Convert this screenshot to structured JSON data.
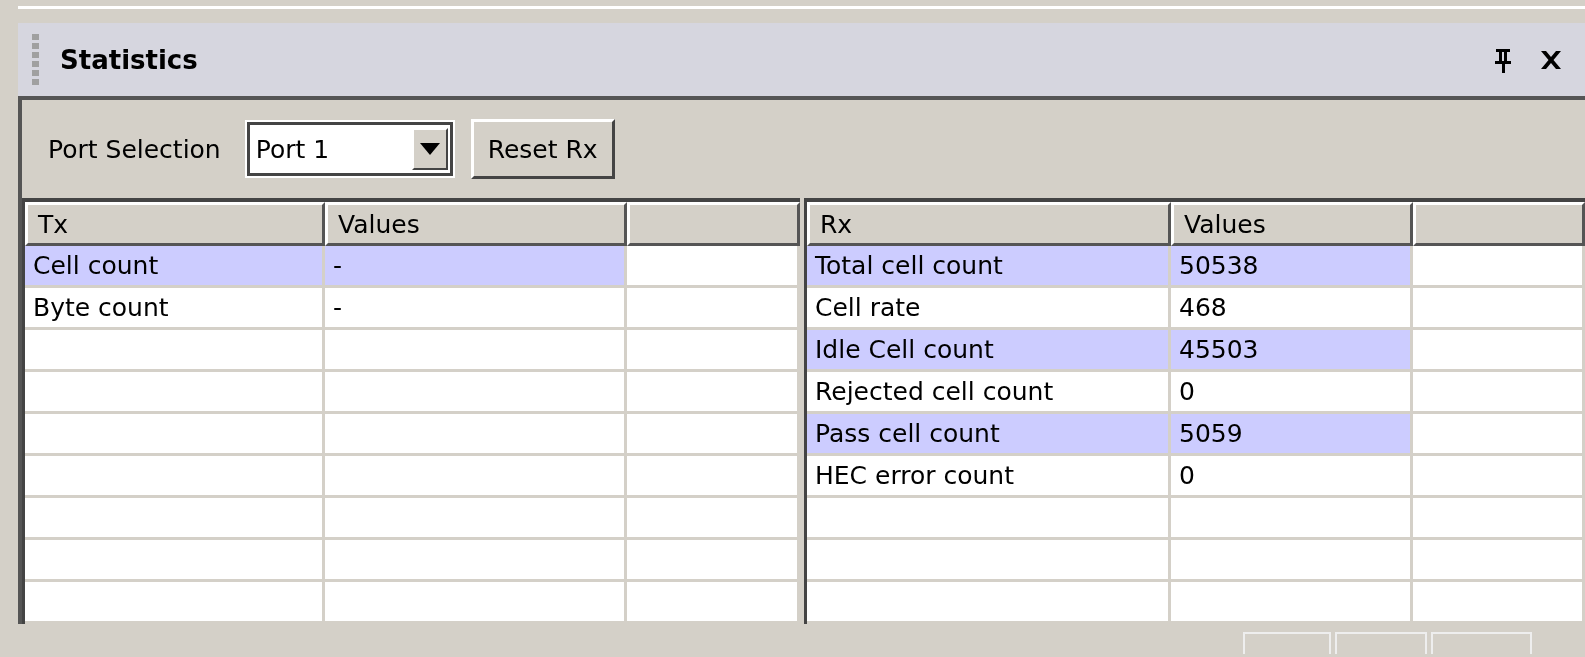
{
  "panel": {
    "title": "Statistics"
  },
  "toolbar": {
    "port_label": "Port Selection",
    "port_select": {
      "value": "Port 1"
    },
    "reset_button": "Reset Rx"
  },
  "tx_table": {
    "columns": [
      "Tx",
      "Values"
    ],
    "rows": [
      {
        "name": "Cell count",
        "value": "-",
        "highlighted": true
      },
      {
        "name": "Byte count",
        "value": "-",
        "highlighted": false
      }
    ]
  },
  "rx_table": {
    "columns": [
      "Rx",
      "Values"
    ],
    "rows": [
      {
        "name": "Total cell count",
        "value": "50538",
        "highlighted": true
      },
      {
        "name": "Cell rate",
        "value": "468",
        "highlighted": false
      },
      {
        "name": "Idle Cell count",
        "value": "45503",
        "highlighted": true
      },
      {
        "name": "Rejected cell count",
        "value": "0",
        "highlighted": false
      },
      {
        "name": "Pass cell count",
        "value": "5059",
        "highlighted": true
      },
      {
        "name": "HEC error count",
        "value": "0",
        "highlighted": false
      }
    ]
  }
}
